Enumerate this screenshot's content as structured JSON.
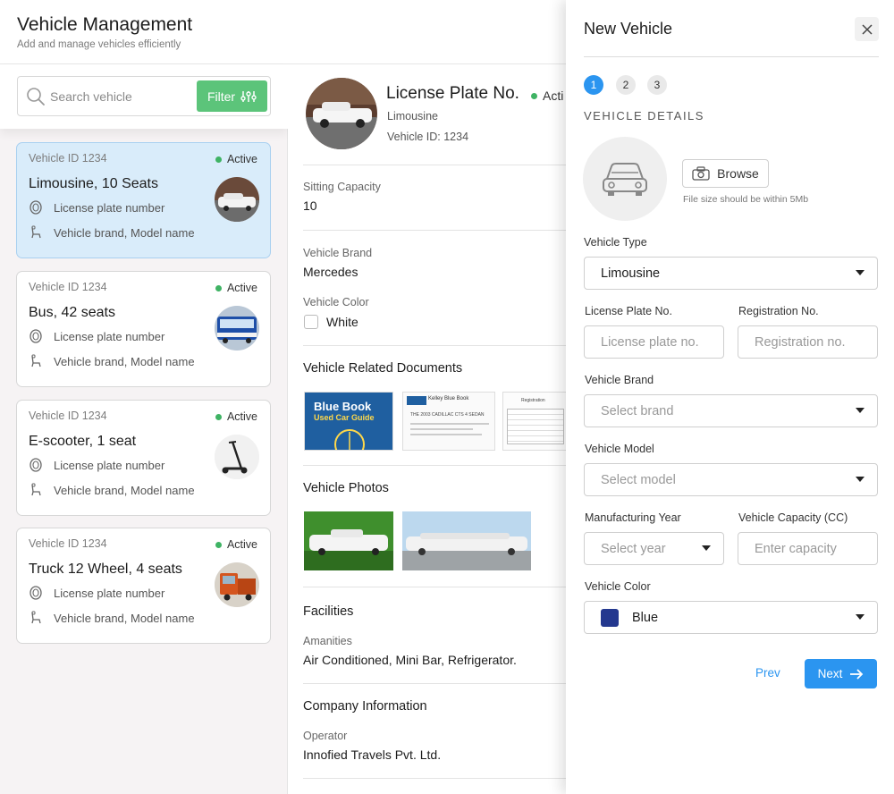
{
  "header": {
    "title": "Vehicle Management",
    "subtitle": "Add and manage vehicles efficiently"
  },
  "search": {
    "placeholder": "Search vehicle",
    "filter_label": "Filter"
  },
  "vehicles": [
    {
      "id_text": "Vehicle ID 1234",
      "status": "Active",
      "name": "Limousine, 10 Seats",
      "plate": "License plate number",
      "brand": "Vehicle brand, Model name",
      "thumb_icon": "limousine-photo"
    },
    {
      "id_text": "Vehicle ID 1234",
      "status": "Active",
      "name": "Bus, 42 seats",
      "plate": "License plate number",
      "brand": "Vehicle brand, Model name",
      "thumb_icon": "bus-photo"
    },
    {
      "id_text": "Vehicle ID 1234",
      "status": "Active",
      "name": "E-scooter, 1 seat",
      "plate": "License plate number",
      "brand": "Vehicle brand, Model name",
      "thumb_icon": "scooter-photo"
    },
    {
      "id_text": "Vehicle ID 1234",
      "status": "Active",
      "name": "Truck 12 Wheel, 4 seats",
      "plate": "License plate number",
      "brand": "Vehicle brand, Model name",
      "thumb_icon": "truck-photo"
    }
  ],
  "detail": {
    "title": "License Plate No.",
    "status": "Acti",
    "type": "Limousine",
    "vehicle_id": "Vehicle ID: 1234",
    "sitting_capacity_label": "Sitting Capacity",
    "sitting_capacity": "10",
    "brand_label": "Vehicle Brand",
    "brand": "Mercedes",
    "color_label": "Vehicle Color",
    "color": "White",
    "documents_title": "Vehicle Related Documents",
    "documents": [
      {
        "title": "Blue Book",
        "subtitle": "Used Car Guide"
      },
      {
        "title": "Kelley Blue Book",
        "subtitle": "THE 2003 CADILLAC CTS 4 SEDAN"
      },
      {
        "title": "Registration",
        "subtitle": ""
      }
    ],
    "photos_title": "Vehicle Photos",
    "facilities_title": "Facilities",
    "amenities_label": "Amanities",
    "amenities": "Air Conditioned, Mini Bar, Refrigerator.",
    "company_title": "Company Information",
    "operator_label": "Operator",
    "operator": "Innofied Travels Pvt. Ltd."
  },
  "drawer": {
    "title": "New Vehicle",
    "steps": [
      "1",
      "2",
      "3"
    ],
    "active_step": 1,
    "section_heading": "VEHICLE DETAILS",
    "browse_label": "Browse",
    "file_hint": "File size should be within 5Mb",
    "vehicle_type_label": "Vehicle Type",
    "vehicle_type_value": "Limousine",
    "license_plate_label": "License Plate No.",
    "license_plate_placeholder": "License plate no.",
    "registration_label": "Registration No.",
    "registration_placeholder": "Registration no.",
    "brand_label": "Vehicle Brand",
    "brand_placeholder": "Select brand",
    "model_label": "Vehicle Model",
    "model_placeholder": "Select model",
    "year_label": "Manufacturing Year",
    "year_placeholder": "Select year",
    "capacity_label": "Vehicle Capacity (CC)",
    "capacity_placeholder": "Enter capacity",
    "color_label": "Vehicle Color",
    "color_value": "Blue",
    "color_hex": "#24388f",
    "prev_label": "Prev",
    "next_label": "Next"
  },
  "colors": {
    "accent": "#2b95f0",
    "success": "#5cc47a",
    "selected_card": "#d9ecfa"
  }
}
